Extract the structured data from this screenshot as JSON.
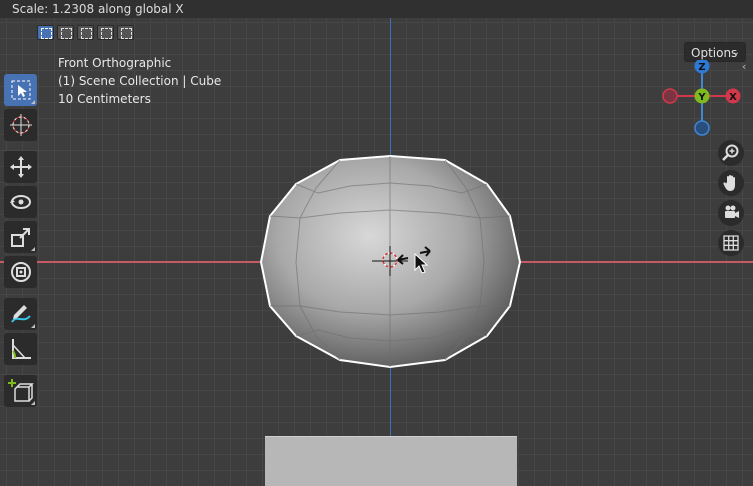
{
  "header": {
    "status_text": "Scale: 1.2308 along global X"
  },
  "viewport": {
    "view_name": "Front Orthographic",
    "collection_path": "(1) Scene Collection | Cube",
    "grid_scale": "10 Centimeters",
    "options_label": "Options"
  },
  "gizmo": {
    "x_label": "X",
    "y_label": "Y",
    "z_label": "Z"
  },
  "colors": {
    "accent": "#4772b3",
    "x_axis": "#c85a66",
    "z_axis": "#3f6fb6",
    "gizmo_x": "#d2384c",
    "gizmo_y": "#7fbb1e",
    "gizmo_z": "#2d7ad6"
  },
  "toolbar": {
    "tools": [
      "select-box-icon",
      "cursor-icon",
      "move-icon",
      "rotate-icon",
      "scale-icon",
      "transform-icon",
      "annotate-icon",
      "measure-icon",
      "add-cube-icon"
    ]
  },
  "nav_tools": [
    "zoom-icon",
    "hand-pan-icon",
    "camera-icon",
    "grid-icon"
  ]
}
